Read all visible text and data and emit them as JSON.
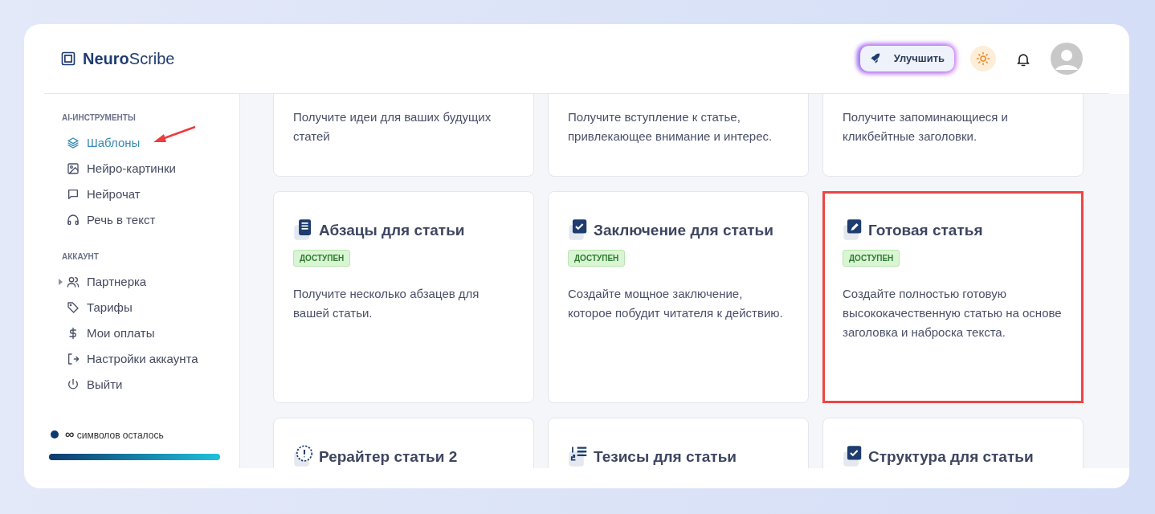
{
  "brand": {
    "bold": "Neuro",
    "light": "Scribe"
  },
  "header": {
    "upgrade_label": "Улучшить"
  },
  "sidebar": {
    "sections": [
      {
        "title": "AI-ИНСТРУМЕНТЫ",
        "items": [
          {
            "label": "Шаблоны",
            "selected": true,
            "has_children": false,
            "pointed": true
          },
          {
            "label": "Нейро-картинки",
            "selected": false,
            "has_children": false,
            "pointed": false
          },
          {
            "label": "Нейрочат",
            "selected": false,
            "has_children": false,
            "pointed": false
          },
          {
            "label": "Речь в текст",
            "selected": false,
            "has_children": false,
            "pointed": false
          }
        ]
      },
      {
        "title": "АККАУНТ",
        "items": [
          {
            "label": "Партнерка",
            "selected": false,
            "has_children": true,
            "pointed": false
          },
          {
            "label": "Тарифы",
            "selected": false,
            "has_children": false,
            "pointed": false
          },
          {
            "label": "Мои оплаты",
            "selected": false,
            "has_children": false,
            "pointed": false
          },
          {
            "label": "Настройки аккаунта",
            "selected": false,
            "has_children": false,
            "pointed": false
          },
          {
            "label": "Выйти",
            "selected": false,
            "has_children": false,
            "pointed": false
          }
        ]
      }
    ],
    "quota": {
      "amount": "∞",
      "text": "символов осталось",
      "level": 1
    }
  },
  "cards": [
    {
      "description": "Получите идеи для ваших будущих статей",
      "highlighted": false
    },
    {
      "description": "Получите вступление к статье, привлекающее внимание и интерес.",
      "highlighted": false
    },
    {
      "description": "Получите запоминающиеся и кликбейтные заголовки.",
      "highlighted": false
    },
    {
      "title": "Абзацы для статьи",
      "badge": "ДОСТУПЕН",
      "description": "Получите несколько абзацев для вашей статьи.",
      "highlighted": false
    },
    {
      "title": "Заключение для статьи",
      "badge": "ДОСТУПЕН",
      "description": "Создайте мощное заключение, которое побудит читателя к действию.",
      "highlighted": false
    },
    {
      "title": "Готовая статья",
      "badge": "ДОСТУПЕН",
      "description": "Создайте полностью готовую высококачественную статью на основе заголовка и наброска текста.",
      "highlighted": true
    },
    {
      "title": "Рерайтер статьи 2",
      "highlighted": false
    },
    {
      "title": "Тезисы для статьи",
      "highlighted": false
    },
    {
      "title": "Структура для статьи",
      "highlighted": false
    }
  ]
}
